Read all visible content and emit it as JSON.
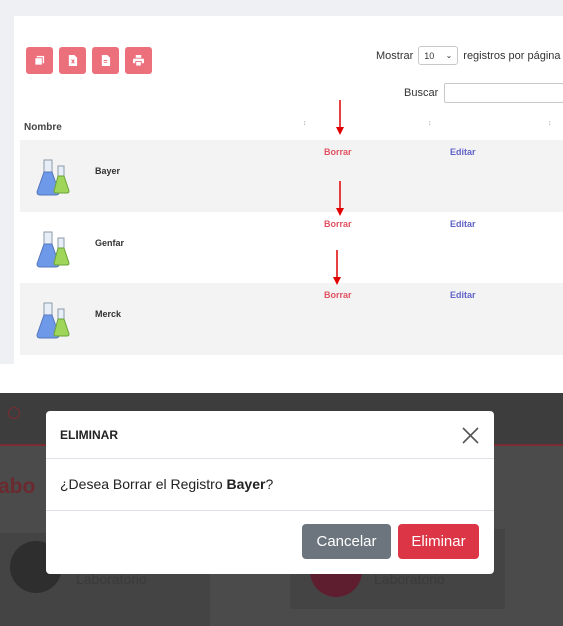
{
  "colors": {
    "accent_button": "#ec6f7c",
    "delete_text": "#e05362",
    "edit_text": "#6163c8",
    "btn_secondary": "#6c757d",
    "btn_danger": "#dc3545"
  },
  "toolbar": {
    "icons": [
      "copy-icon",
      "excel-file-icon",
      "pdf-file-icon",
      "print-icon"
    ]
  },
  "length_menu": {
    "prefix": "Mostrar",
    "value": "10",
    "suffix": "registros por página"
  },
  "search": {
    "label": "Buscar",
    "value": ""
  },
  "table": {
    "column_header": "Nombre",
    "rows": [
      {
        "name": "Bayer",
        "delete": "Borrar",
        "edit": "Editar"
      },
      {
        "name": "Genfar",
        "delete": "Borrar",
        "edit": "Editar"
      },
      {
        "name": "Merck",
        "delete": "Borrar",
        "edit": "Editar"
      }
    ]
  },
  "background": {
    "title_fragment": "abo",
    "card_label_1": "Laboratorio",
    "card_label_2": "Laboratorio"
  },
  "modal": {
    "title": "ELIMINAR",
    "message_prefix": "¿Desea Borrar el Registro ",
    "message_name": "Bayer",
    "message_suffix": "?",
    "cancel_label": "Cancelar",
    "confirm_label": "Eliminar"
  }
}
